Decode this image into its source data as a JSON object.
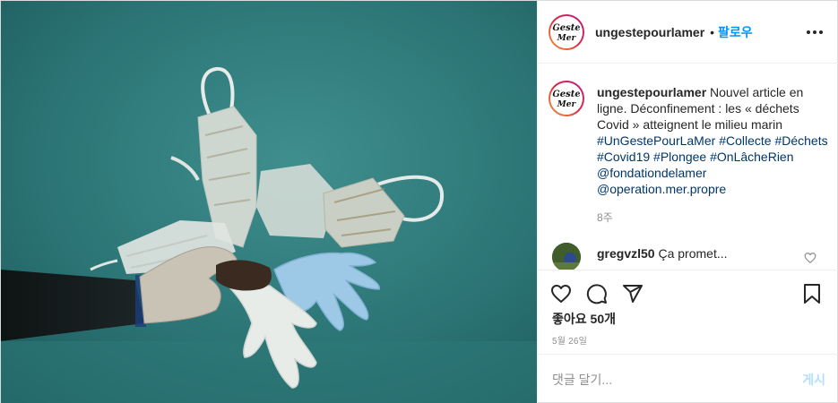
{
  "photo": {
    "alt_subject": "underwater-waste",
    "colors": {
      "water": "#2f7d7e",
      "water_deep": "#1f5e60",
      "glove": "#9bc7e6",
      "mask": "#dfe6e3"
    }
  },
  "header": {
    "username": "ungestepourlamer",
    "separator": "•",
    "follow_label": "팔로우",
    "logo_text_top": "Geste",
    "logo_text_bottom": "Mer"
  },
  "caption": {
    "username": "ungestepourlamer",
    "text": "Nouvel article en ligne. Déconfinement : les « déchets Covid » atteignent le milieu marin",
    "hashtags": [
      "#UnGestePourLaMer",
      "#Collecte",
      "#Déchets",
      "#Covid19",
      "#Plongee",
      "#OnLâcheRien",
      "@fondationdelamer",
      "@operation.mer.propre"
    ],
    "time": "8주"
  },
  "comments": [
    {
      "username": "gregvzl50",
      "text": "Ça promet..."
    }
  ],
  "actions": {
    "likes": "좋아요 50개",
    "date": "5월 26일"
  },
  "add_comment": {
    "placeholder": "댓글 달기...",
    "post_label": "게시"
  },
  "colors": {
    "accent": "#0095f6",
    "link": "#00376b",
    "muted": "#8e8e8e",
    "post_disabled": "#b2dffc"
  },
  "icons": [
    "heart-icon",
    "comment-icon",
    "share-icon",
    "bookmark-icon",
    "more-icon"
  ]
}
